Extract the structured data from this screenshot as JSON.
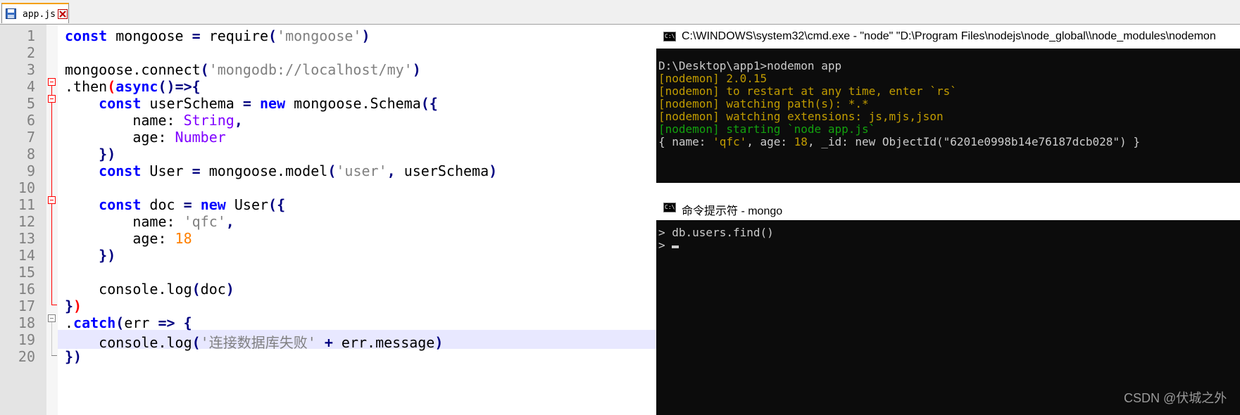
{
  "editor": {
    "tab": {
      "label": "app.js"
    },
    "lines": [
      {
        "num": "1",
        "tokens": [
          {
            "t": "kw",
            "v": "const"
          },
          {
            "t": "",
            "v": " mongoose "
          },
          {
            "t": "op",
            "v": "="
          },
          {
            "t": "",
            "v": " require"
          },
          {
            "t": "br",
            "v": "("
          },
          {
            "t": "str",
            "v": "'mongoose'"
          },
          {
            "t": "br",
            "v": ")"
          }
        ]
      },
      {
        "num": "2",
        "tokens": []
      },
      {
        "num": "3",
        "tokens": [
          {
            "t": "",
            "v": "mongoose.connect"
          },
          {
            "t": "br",
            "v": "("
          },
          {
            "t": "str",
            "v": "'mongodb://localhost/my'"
          },
          {
            "t": "br",
            "v": ")"
          }
        ]
      },
      {
        "num": "4",
        "tokens": [
          {
            "t": "",
            "v": ".then"
          },
          {
            "t": "brr",
            "v": "("
          },
          {
            "t": "kw",
            "v": "async"
          },
          {
            "t": "br",
            "v": "()"
          },
          {
            "t": "op",
            "v": "=>{"
          }
        ]
      },
      {
        "num": "5",
        "tokens": [
          {
            "t": "",
            "v": "    "
          },
          {
            "t": "kw",
            "v": "const"
          },
          {
            "t": "",
            "v": " userSchema "
          },
          {
            "t": "op",
            "v": "="
          },
          {
            "t": "",
            "v": " "
          },
          {
            "t": "kw",
            "v": "new"
          },
          {
            "t": "",
            "v": " mongoose.Schema"
          },
          {
            "t": "br",
            "v": "({"
          }
        ]
      },
      {
        "num": "6",
        "tokens": [
          {
            "t": "",
            "v": "        name: "
          },
          {
            "t": "ty",
            "v": "String"
          },
          {
            "t": "op",
            "v": ","
          }
        ]
      },
      {
        "num": "7",
        "tokens": [
          {
            "t": "",
            "v": "        age: "
          },
          {
            "t": "ty",
            "v": "Number"
          }
        ]
      },
      {
        "num": "8",
        "tokens": [
          {
            "t": "",
            "v": "    "
          },
          {
            "t": "br",
            "v": "})"
          }
        ]
      },
      {
        "num": "9",
        "tokens": [
          {
            "t": "",
            "v": "    "
          },
          {
            "t": "kw",
            "v": "const"
          },
          {
            "t": "",
            "v": " User "
          },
          {
            "t": "op",
            "v": "="
          },
          {
            "t": "",
            "v": " mongoose.model"
          },
          {
            "t": "br",
            "v": "("
          },
          {
            "t": "str",
            "v": "'user'"
          },
          {
            "t": "op",
            "v": ","
          },
          {
            "t": "",
            "v": " userSchema"
          },
          {
            "t": "br",
            "v": ")"
          }
        ]
      },
      {
        "num": "10",
        "tokens": []
      },
      {
        "num": "11",
        "tokens": [
          {
            "t": "",
            "v": "    "
          },
          {
            "t": "kw",
            "v": "const"
          },
          {
            "t": "",
            "v": " doc "
          },
          {
            "t": "op",
            "v": "="
          },
          {
            "t": "",
            "v": " "
          },
          {
            "t": "kw",
            "v": "new"
          },
          {
            "t": "",
            "v": " User"
          },
          {
            "t": "br",
            "v": "({"
          }
        ]
      },
      {
        "num": "12",
        "tokens": [
          {
            "t": "",
            "v": "        name: "
          },
          {
            "t": "str",
            "v": "'qfc'"
          },
          {
            "t": "op",
            "v": ","
          }
        ]
      },
      {
        "num": "13",
        "tokens": [
          {
            "t": "",
            "v": "        age: "
          },
          {
            "t": "num",
            "v": "18"
          }
        ]
      },
      {
        "num": "14",
        "tokens": [
          {
            "t": "",
            "v": "    "
          },
          {
            "t": "br",
            "v": "})"
          }
        ]
      },
      {
        "num": "15",
        "tokens": []
      },
      {
        "num": "16",
        "tokens": [
          {
            "t": "",
            "v": "    console.log"
          },
          {
            "t": "br",
            "v": "("
          },
          {
            "t": "",
            "v": "doc"
          },
          {
            "t": "br",
            "v": ")"
          }
        ]
      },
      {
        "num": "17",
        "tokens": [
          {
            "t": "br",
            "v": "}"
          },
          {
            "t": "brr",
            "v": ")"
          }
        ]
      },
      {
        "num": "18",
        "tokens": [
          {
            "t": "",
            "v": "."
          },
          {
            "t": "kw",
            "v": "catch"
          },
          {
            "t": "br",
            "v": "("
          },
          {
            "t": "",
            "v": "err "
          },
          {
            "t": "op",
            "v": "=>"
          },
          {
            "t": "",
            "v": " "
          },
          {
            "t": "br",
            "v": "{"
          }
        ]
      },
      {
        "num": "19",
        "tokens": [
          {
            "t": "",
            "v": "    console.log"
          },
          {
            "t": "br",
            "v": "("
          },
          {
            "t": "str",
            "v": "'连接数据库失败'"
          },
          {
            "t": "",
            "v": " "
          },
          {
            "t": "op",
            "v": "+"
          },
          {
            "t": "",
            "v": " err.message"
          },
          {
            "t": "br",
            "v": ")"
          }
        ]
      },
      {
        "num": "20",
        "tokens": [
          {
            "t": "br",
            "v": "})"
          }
        ]
      }
    ]
  },
  "console_node": {
    "title": "C:\\WINDOWS\\system32\\cmd.exe - \"node\"   \"D:\\Program Files\\nodejs\\node_global\\\\node_modules\\nodemon",
    "lines": [
      {
        "color": "w",
        "text": "D:\\Desktop\\app1>nodemon app"
      },
      {
        "color": "y",
        "text": "[nodemon] 2.0.15"
      },
      {
        "color": "y",
        "text": "[nodemon] to restart at any time, enter `rs`"
      },
      {
        "color": "y",
        "text": "[nodemon] watching path(s): *.*"
      },
      {
        "color": "y",
        "text": "[nodemon] watching extensions: js,mjs,json"
      },
      {
        "color": "g",
        "text": "[nodemon] starting `node app.js`"
      },
      {
        "color": "mix",
        "segments": [
          {
            "c": "w",
            "v": "{ name: "
          },
          {
            "c": "y",
            "v": "'qfc'"
          },
          {
            "c": "w",
            "v": ", age: "
          },
          {
            "c": "y",
            "v": "18"
          },
          {
            "c": "w",
            "v": ", _id: new ObjectId(\"6201e0998b14e76187dcb028\") }"
          }
        ]
      }
    ]
  },
  "console_mongo": {
    "title": "命令提示符 - mongo",
    "lines": [
      {
        "color": "w",
        "text": "> db.users.find()"
      },
      {
        "color": "w",
        "text": ">"
      }
    ]
  },
  "watermark": "CSDN @伏城之外"
}
